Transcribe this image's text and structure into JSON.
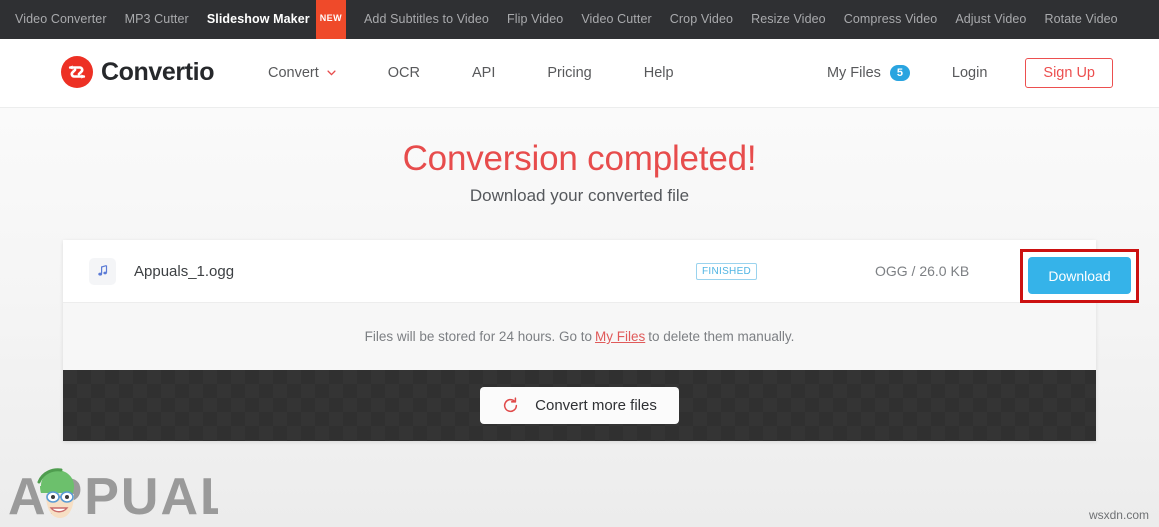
{
  "topbar": {
    "items": [
      {
        "label": "Video Converter",
        "active": false,
        "badge": null
      },
      {
        "label": "MP3 Cutter",
        "active": false,
        "badge": null
      },
      {
        "label": "Slideshow Maker",
        "active": true,
        "badge": "NEW"
      },
      {
        "label": "Add Subtitles to Video",
        "active": false,
        "badge": null
      },
      {
        "label": "Flip Video",
        "active": false,
        "badge": null
      },
      {
        "label": "Video Cutter",
        "active": false,
        "badge": null
      },
      {
        "label": "Crop Video",
        "active": false,
        "badge": null
      },
      {
        "label": "Resize Video",
        "active": false,
        "badge": null
      },
      {
        "label": "Compress Video",
        "active": false,
        "badge": null
      },
      {
        "label": "Adjust Video",
        "active": false,
        "badge": null
      },
      {
        "label": "Rotate Video",
        "active": false,
        "badge": null
      }
    ]
  },
  "header": {
    "brand": "Convertio",
    "logo_icon": "convertio-circle-arrows-icon",
    "nav": [
      {
        "label": "Convert",
        "has_dropdown": true
      },
      {
        "label": "OCR",
        "has_dropdown": false
      },
      {
        "label": "API",
        "has_dropdown": false
      },
      {
        "label": "Pricing",
        "has_dropdown": false
      },
      {
        "label": "Help",
        "has_dropdown": false
      }
    ],
    "my_files_label": "My Files",
    "my_files_count": "5",
    "login_label": "Login",
    "signup_label": "Sign Up"
  },
  "main": {
    "title": "Conversion completed!",
    "subtitle": "Download your converted file",
    "file": {
      "icon": "music-note-icon",
      "name": "Appuals_1.ogg",
      "status": "FINISHED",
      "meta": "OGG / 26.0 KB",
      "download_label": "Download"
    },
    "notice": {
      "before": "Files will be stored for 24 hours. Go to",
      "link": "My Files",
      "after": "to delete them manually."
    },
    "footer": {
      "convert_more_label": "Convert more files",
      "refresh_icon": "refresh-icon"
    }
  },
  "watermarks": {
    "appuals": "APPUALS",
    "site": "wsxdn.com"
  },
  "colors": {
    "accent_red": "#e74c4c",
    "blue_button": "#35b3e9",
    "badge_blue": "#29a4e0",
    "new_badge_orange": "#ef4a2a",
    "highlight_red": "#cc1111",
    "topbar_dark": "#2f3033",
    "footer_dark": "#343434"
  }
}
